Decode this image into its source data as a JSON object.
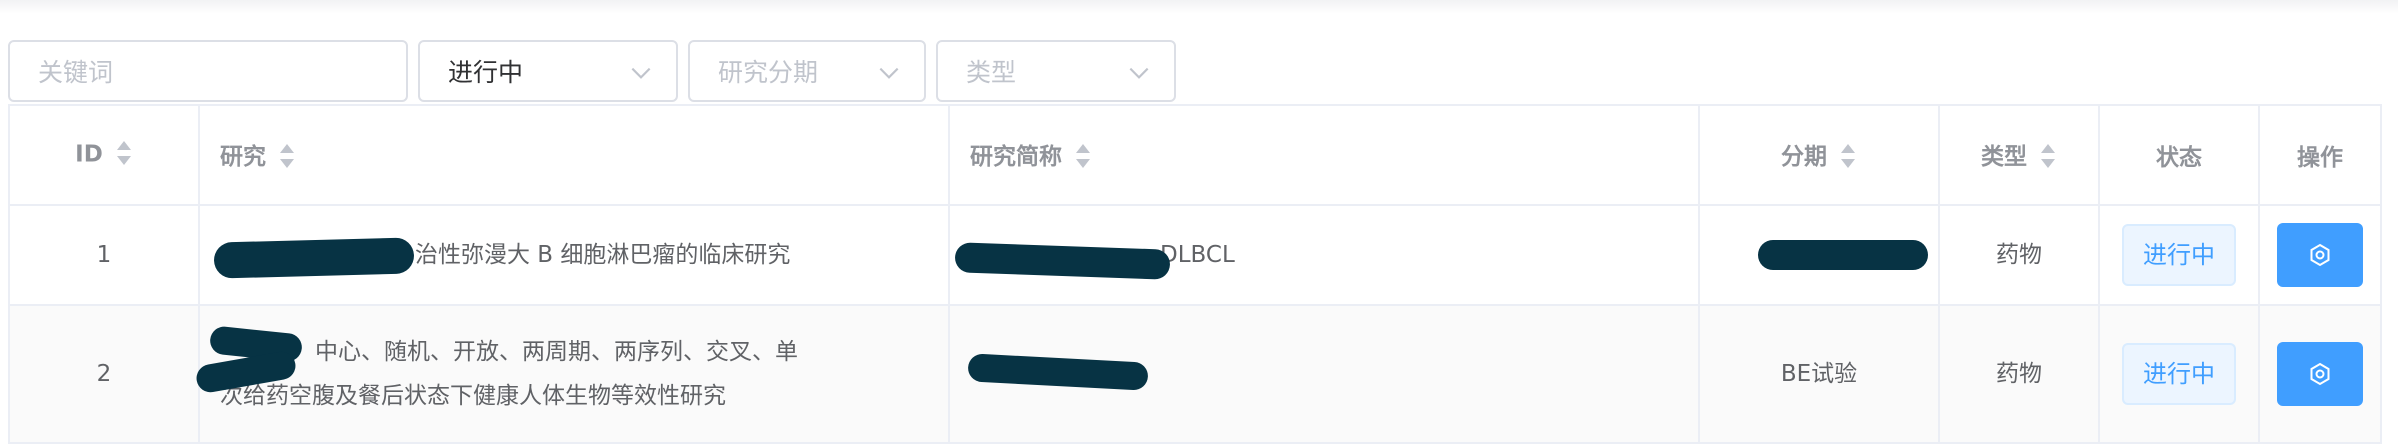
{
  "filters": {
    "keyword_placeholder": "关键词",
    "status_value": "进行中",
    "stage_placeholder": "研究分期",
    "type_placeholder": "类型"
  },
  "table": {
    "headers": {
      "id": "ID",
      "study": "研究",
      "short_name": "研究简称",
      "stage": "分期",
      "type": "类型",
      "status": "状态",
      "action": "操作"
    },
    "rows": [
      {
        "id": "1",
        "study": "治性弥漫大 B 细胞淋巴瘤的临床研究",
        "short_name": "DLBCL",
        "stage": "",
        "type": "药物",
        "status": "进行中"
      },
      {
        "id": "2",
        "study_line1": "中心、随机、开放、两周期、两序列、交叉、单",
        "study_line2": "次给药空腹及餐后状态下健康人体生物等效性研究",
        "short_name": "",
        "stage": "BE试验",
        "type": "药物",
        "status": "进行中"
      }
    ]
  },
  "colors": {
    "primary": "#409eff",
    "tag_bg": "#ecf5ff",
    "redaction": "#073344",
    "border": "#ebeef5"
  },
  "icons": {
    "select_arrow": "chevron-down-icon",
    "sort": "sort-caret-icon",
    "action": "gear-icon"
  }
}
